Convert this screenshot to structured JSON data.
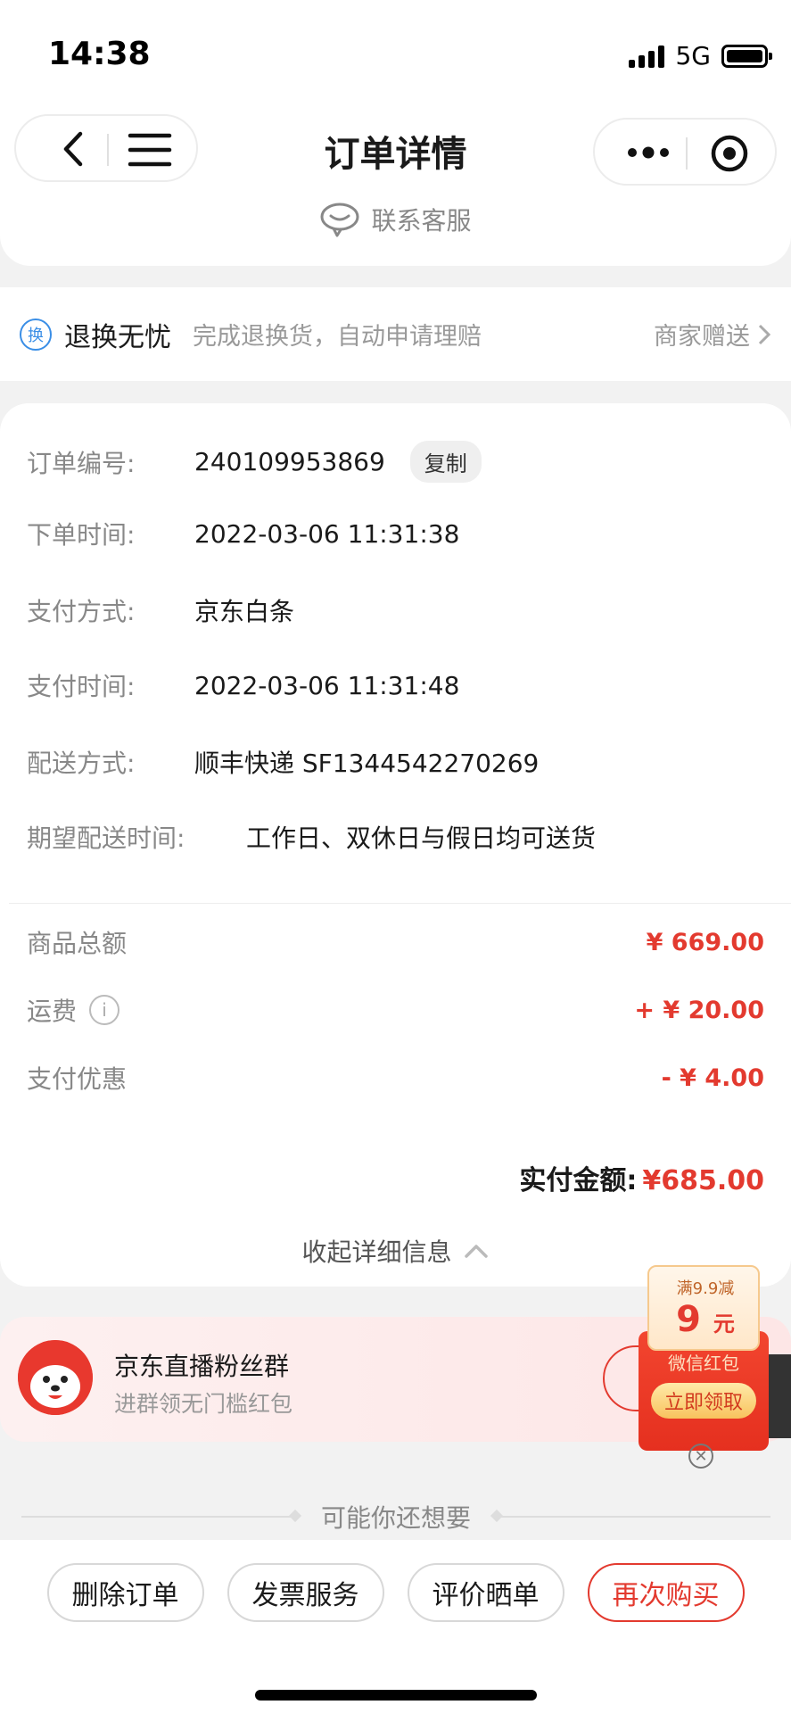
{
  "status_bar": {
    "time": "14:38",
    "network": "5G"
  },
  "header": {
    "title": "订单详情",
    "contact_label": "联系客服"
  },
  "return_card": {
    "icon_char": "换",
    "title": "退换无忧",
    "desc": "完成退换货，自动申请理赔",
    "right_label": "商家赠送"
  },
  "order": {
    "rows": [
      {
        "label": "订单编号:",
        "value": "240109953869"
      },
      {
        "label": "下单时间:",
        "value": "2022-03-06 11:31:38"
      },
      {
        "label": "支付方式:",
        "value": "京东白条"
      },
      {
        "label": "支付时间:",
        "value": "2022-03-06 11:31:48"
      },
      {
        "label": "配送方式:",
        "value": "顺丰快递 SF1344542270269"
      },
      {
        "label": "期望配送时间:",
        "value": "工作日、双休日与假日均可送货"
      }
    ],
    "copy_label": "复制",
    "prices": [
      {
        "label": "商品总额",
        "value": "¥ 669.00"
      },
      {
        "label": "运费",
        "value": "+ ¥ 20.00"
      },
      {
        "label": "支付优惠",
        "value": "- ¥ 4.00"
      }
    ],
    "total_label": "实付金额:",
    "total_value": "¥685.00",
    "collapse_label": "收起详细信息"
  },
  "live_group": {
    "title": "京东直播粉丝群",
    "subtitle": "进群领无门槛红包"
  },
  "red_packet": {
    "condition": "满9.9减",
    "amount": "9",
    "unit": "元",
    "label": "微信红包",
    "button": "立即领取"
  },
  "recommend_label": "可能你还想要",
  "bottom_buttons": {
    "delete": "删除订单",
    "invoice": "发票服务",
    "review": "评价晒单",
    "rebuy": "再次购买"
  },
  "colors": {
    "accent_red": "#e33a2f",
    "blue": "#3a8ee6"
  }
}
